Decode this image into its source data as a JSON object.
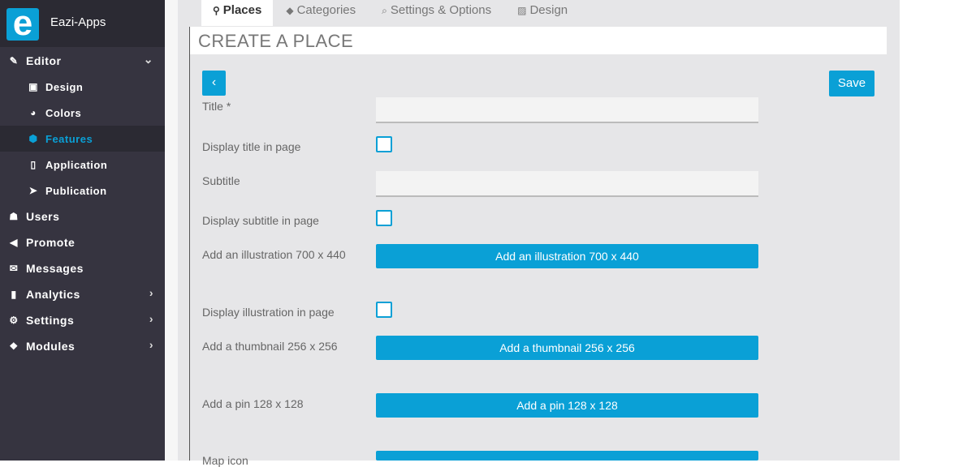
{
  "app": {
    "name": "Eazi-Apps",
    "logo_letter": "e"
  },
  "sidebar": {
    "editor": {
      "label": "Editor"
    },
    "sub_items": [
      {
        "label": "Design"
      },
      {
        "label": "Colors"
      },
      {
        "label": "Features"
      },
      {
        "label": "Application"
      },
      {
        "label": "Publication"
      }
    ],
    "items": [
      {
        "label": "Users"
      },
      {
        "label": "Promote"
      },
      {
        "label": "Messages"
      },
      {
        "label": "Analytics"
      },
      {
        "label": "Settings"
      },
      {
        "label": "Modules"
      }
    ]
  },
  "tabs": [
    {
      "label": "Places"
    },
    {
      "label": "Categories"
    },
    {
      "label": "Settings & Options"
    },
    {
      "label": "Design"
    }
  ],
  "page": {
    "title": "CREATE A PLACE",
    "save_label": "Save"
  },
  "form": {
    "title_label": "Title *",
    "display_title_label": "Display title in page",
    "subtitle_label": "Subtitle",
    "display_subtitle_label": "Display subtitle in page",
    "illustration_label": "Add an illustration 700 x 440",
    "illustration_button": "Add an illustration 700 x 440",
    "display_illustration_label": "Display illustration in page",
    "thumbnail_label": "Add a thumbnail 256 x 256",
    "thumbnail_button": "Add a thumbnail 256 x 256",
    "pin_label": "Add a pin 128 x 128",
    "pin_button": "Add a pin 128 x 128",
    "map_icon_label": "Map icon"
  },
  "colors": {
    "accent": "#0aa0d6",
    "sidebar_bg": "#363440"
  }
}
